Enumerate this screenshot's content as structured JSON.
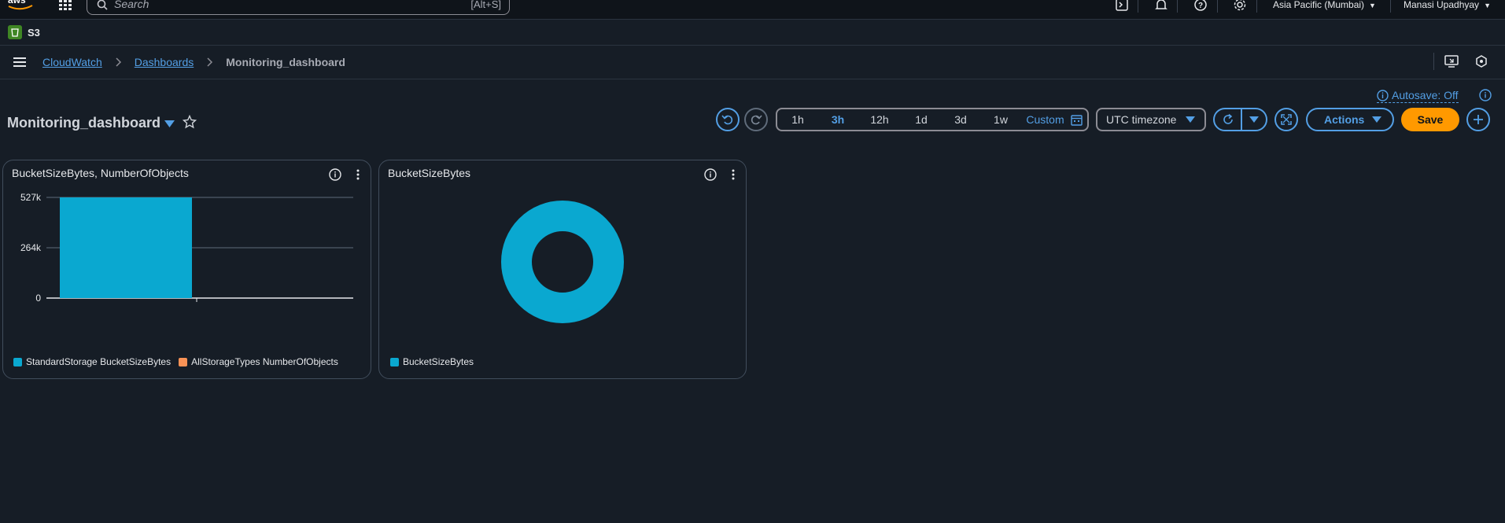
{
  "topnav": {
    "search_placeholder": "Search",
    "search_shortcut": "[Alt+S]",
    "region": "Asia Pacific (Mumbai)",
    "user": "Manasi Upadhyay"
  },
  "service": {
    "label": "S3"
  },
  "breadcrumb": {
    "items": [
      "CloudWatch",
      "Dashboards"
    ],
    "current": "Monitoring_dashboard"
  },
  "header": {
    "title": "Monitoring_dashboard",
    "autosave": "Autosave: Off",
    "time_ranges": [
      "1h",
      "3h",
      "12h",
      "1d",
      "3d",
      "1w"
    ],
    "active_range": "3h",
    "custom_label": "Custom",
    "timezone": "UTC timezone",
    "actions_label": "Actions",
    "save_label": "Save"
  },
  "colors": {
    "accent": "#539fe5",
    "save": "#ff9900",
    "series_blue": "#0aa8d0",
    "series_orange": "#f89256"
  },
  "widgets": [
    {
      "title": "BucketSizeBytes, NumberOfObjects",
      "legend": [
        "StandardStorage BucketSizeBytes",
        "AllStorageTypes NumberOfObjects"
      ]
    },
    {
      "title": "BucketSizeBytes",
      "legend": [
        "BucketSizeBytes"
      ]
    }
  ],
  "chart_data": [
    {
      "type": "bar",
      "title": "BucketSizeBytes, NumberOfObjects",
      "y_ticks": [
        "0",
        "264k",
        "527k"
      ],
      "ylim": [
        0,
        527000
      ],
      "grid": true,
      "legend_position": "bottom",
      "series": [
        {
          "name": "StandardStorage BucketSizeBytes",
          "values": [
            527000
          ],
          "color": "#0aa8d0"
        },
        {
          "name": "AllStorageTypes NumberOfObjects",
          "values": [],
          "color": "#f89256"
        }
      ]
    },
    {
      "type": "pie",
      "title": "BucketSizeBytes",
      "legend_position": "bottom",
      "series": [
        {
          "name": "BucketSizeBytes",
          "values": [
            100
          ],
          "color": "#0aa8d0"
        }
      ]
    }
  ]
}
